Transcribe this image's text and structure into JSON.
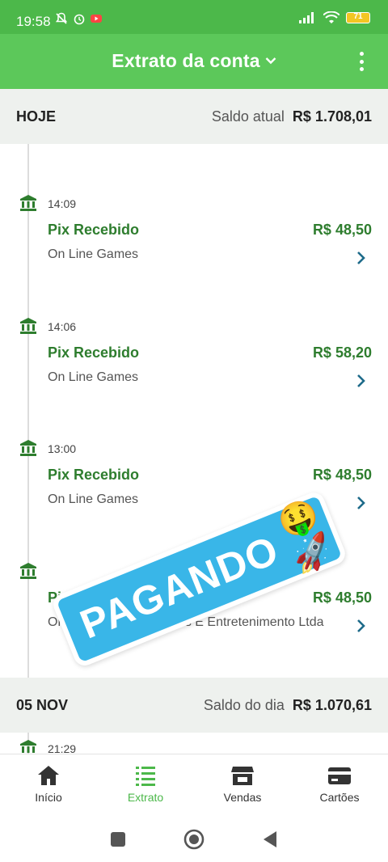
{
  "status_bar": {
    "time": "19:58",
    "battery": "71"
  },
  "app_bar": {
    "title": "Extrato da conta"
  },
  "today": {
    "label": "HOJE",
    "balance_label": "Saldo atual",
    "balance_value": "R$ 1.708,01"
  },
  "transactions": [
    {
      "time": "14:09",
      "title": "Pix Recebido",
      "amount": "R$ 48,50",
      "subtitle": "On Line Games"
    },
    {
      "time": "14:06",
      "title": "Pix Recebido",
      "amount": "R$ 58,20",
      "subtitle": "On Line Games"
    },
    {
      "time": "13:00",
      "title": "Pix Recebido",
      "amount": "R$ 48,50",
      "subtitle": "On Line Games"
    },
    {
      "time": "",
      "title": "Pix Recebido",
      "amount": "R$ 48,50",
      "subtitle": "Online Games Diversões E Entretenimento Ltda"
    }
  ],
  "prev_day": {
    "label": "05 NOV",
    "balance_label": "Saldo do dia",
    "balance_value": "R$ 1.070,61"
  },
  "prev_transactions": [
    {
      "time": "21:29"
    }
  ],
  "sticker": {
    "text": "PAGANDO",
    "emoji": "🤑🚀"
  },
  "bottom_nav": [
    {
      "label": "Início",
      "icon": "home-icon"
    },
    {
      "label": "Extrato",
      "icon": "list-icon",
      "active": true
    },
    {
      "label": "Vendas",
      "icon": "store-icon"
    },
    {
      "label": "Cartões",
      "icon": "card-icon"
    }
  ],
  "colors": {
    "primary": "#5cc85a",
    "status": "#4cb84a",
    "text_green": "#2e7d2e",
    "arrow": "#1e6b8a",
    "sticker": "#39b6e8"
  }
}
